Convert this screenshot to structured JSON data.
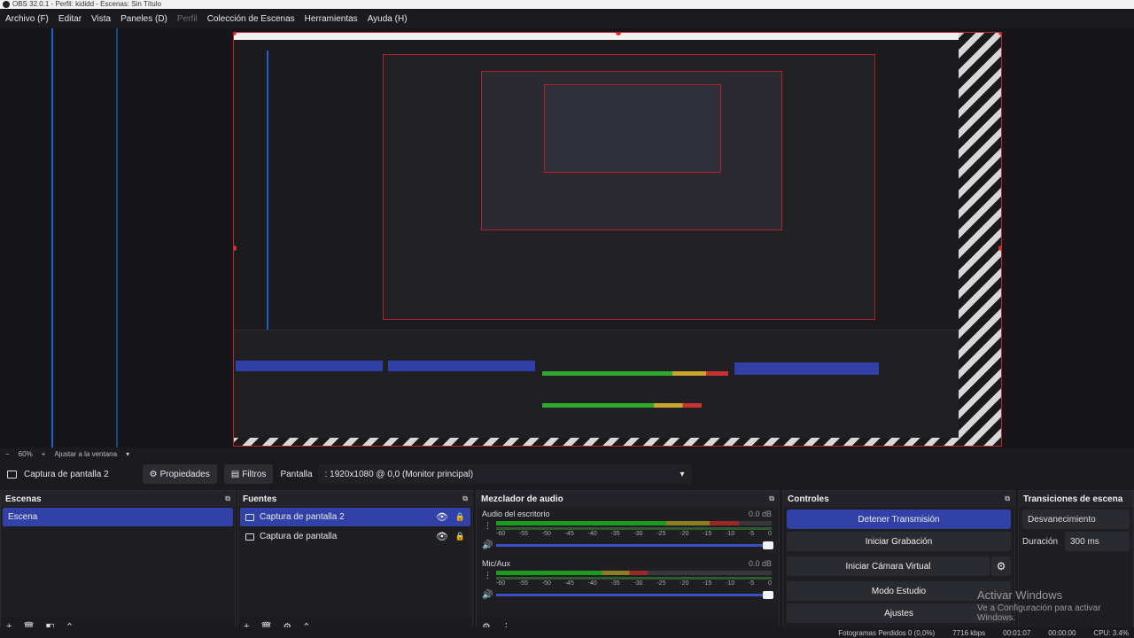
{
  "window": {
    "title": "OBS 32.0.1 - Perfil: kididd - Escenas: Sin Título"
  },
  "menu": [
    {
      "label": "Archivo (F)",
      "disabled": false
    },
    {
      "label": "Editar",
      "disabled": false
    },
    {
      "label": "Vista",
      "disabled": false
    },
    {
      "label": "Paneles (D)",
      "disabled": false
    },
    {
      "label": "Perfil",
      "disabled": true
    },
    {
      "label": "Colección de Escenas",
      "disabled": false
    },
    {
      "label": "Herramientas",
      "disabled": false
    },
    {
      "label": "Ayuda (H)",
      "disabled": false
    }
  ],
  "zoom": {
    "minus": "−",
    "level": "60%",
    "plus": "+",
    "fit": "Ajustar a la ventana",
    "arrow": "▾"
  },
  "source_toolbar": {
    "source_name": "Captura de pantalla 2",
    "properties": "Propiedades",
    "filters": "Filtros",
    "display_label": "Pantalla",
    "display_value": ": 1920x1080 @ 0,0 (Monitor principal)"
  },
  "scenes": {
    "title": "Escenas",
    "items": [
      "Escena"
    ],
    "selected": 0
  },
  "sources": {
    "title": "Fuentes",
    "items": [
      {
        "name": "Captura de pantalla 2",
        "selected": true
      },
      {
        "name": "Captura de pantalla",
        "selected": false
      }
    ]
  },
  "mixer": {
    "title": "Mezclador de audio",
    "tracks": [
      {
        "name": "Audio del escritorio",
        "db": "0.0 dB",
        "level": 0.88
      },
      {
        "name": "Mic/Aux",
        "db": "0.0 dB",
        "level": 0.55
      }
    ],
    "scale": [
      "-60",
      "-55",
      "-50",
      "-45",
      "-40",
      "-35",
      "-30",
      "-25",
      "-20",
      "-15",
      "-10",
      "-5",
      "0"
    ]
  },
  "controls": {
    "title": "Controles",
    "stop_stream": "Detener Transmisión",
    "start_recording": "Iniciar Grabación",
    "virtual_cam": "Iniciar Cámara Virtual",
    "studio_mode": "Modo Estudio",
    "settings": "Ajustes"
  },
  "transitions": {
    "title": "Transiciones de escena",
    "selected": "Desvanecimiento",
    "duration_label": "Duración",
    "duration_value": "300 ms"
  },
  "watermark": {
    "line1": "Activar Windows",
    "line2": "Ve a Configuración para activar Windows."
  },
  "status": {
    "dropped": "Fotogramas Perdidos 0 (0,0%)",
    "bitrate": "7716 kbps",
    "live_time": "00:01:07",
    "rec_time": "00:00:00",
    "cpu": "CPU: 3.4%"
  },
  "colors": {
    "accent": "#3141a8",
    "canvas_border": "#c0262c",
    "guide": "#1f5fcf"
  }
}
